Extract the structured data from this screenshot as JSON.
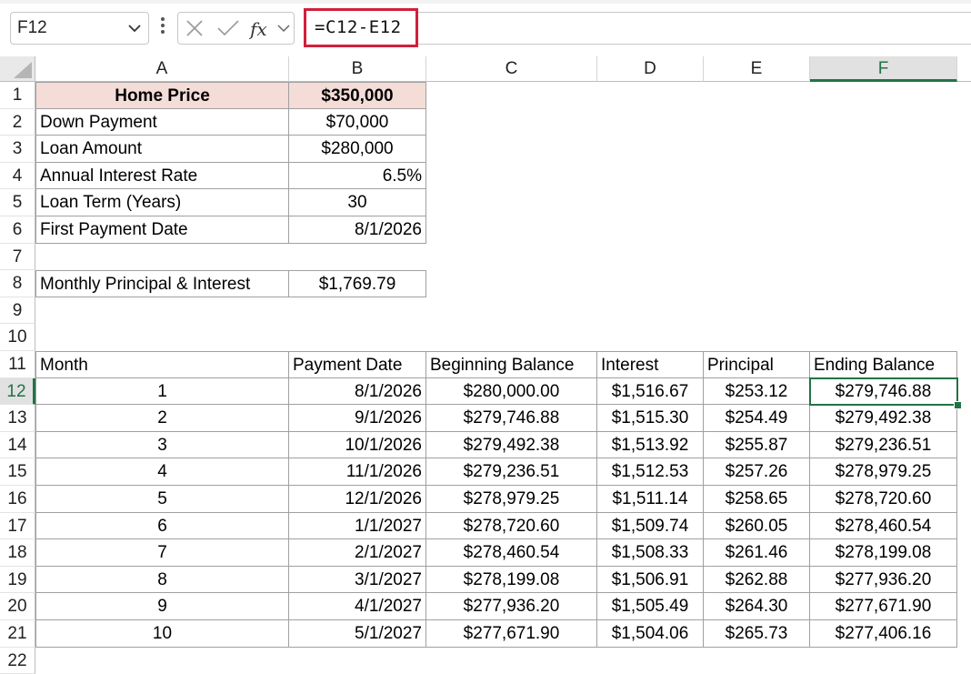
{
  "formula_bar": {
    "name_box": "F12",
    "formula": "=C12-E12"
  },
  "columns": [
    "A",
    "B",
    "C",
    "D",
    "E",
    "F"
  ],
  "rows": [
    "1",
    "2",
    "3",
    "4",
    "5",
    "6",
    "7",
    "8",
    "9",
    "10",
    "11",
    "12",
    "13",
    "14",
    "15",
    "16",
    "17",
    "18",
    "19",
    "20",
    "21",
    "22"
  ],
  "inputs": [
    {
      "label": "Home Price",
      "value": "$350,000"
    },
    {
      "label": "Down Payment",
      "value": "$70,000"
    },
    {
      "label": "Loan Amount",
      "value": "$280,000"
    },
    {
      "label": "Annual Interest Rate",
      "value": "6.5%"
    },
    {
      "label": "Loan Term (Years)",
      "value": "30"
    },
    {
      "label": "First Payment Date",
      "value": "8/1/2026"
    }
  ],
  "monthly_payment": {
    "label": "Monthly Principal & Interest",
    "value": "$1,769.79"
  },
  "table": {
    "headers": [
      "Month",
      "Payment Date",
      "Beginning Balance",
      "Interest",
      "Principal",
      "Ending Balance"
    ],
    "rows": [
      [
        "1",
        "8/1/2026",
        "$280,000.00",
        "$1,516.67",
        "$253.12",
        "$279,746.88"
      ],
      [
        "2",
        "9/1/2026",
        "$279,746.88",
        "$1,515.30",
        "$254.49",
        "$279,492.38"
      ],
      [
        "3",
        "10/1/2026",
        "$279,492.38",
        "$1,513.92",
        "$255.87",
        "$279,236.51"
      ],
      [
        "4",
        "11/1/2026",
        "$279,236.51",
        "$1,512.53",
        "$257.26",
        "$278,979.25"
      ],
      [
        "5",
        "12/1/2026",
        "$278,979.25",
        "$1,511.14",
        "$258.65",
        "$278,720.60"
      ],
      [
        "6",
        "1/1/2027",
        "$278,720.60",
        "$1,509.74",
        "$260.05",
        "$278,460.54"
      ],
      [
        "7",
        "2/1/2027",
        "$278,460.54",
        "$1,508.33",
        "$261.46",
        "$278,199.08"
      ],
      [
        "8",
        "3/1/2027",
        "$278,199.08",
        "$1,506.91",
        "$262.88",
        "$277,936.20"
      ],
      [
        "9",
        "4/1/2027",
        "$277,936.20",
        "$1,505.49",
        "$264.30",
        "$277,671.90"
      ],
      [
        "10",
        "5/1/2027",
        "$277,671.90",
        "$1,504.06",
        "$265.73",
        "$277,406.16"
      ]
    ]
  },
  "selection": {
    "column": "F",
    "row": "12"
  },
  "colors": {
    "accent": "#217346",
    "highlight": "#d21f3c",
    "pink_fill": "#f4dcd7"
  }
}
